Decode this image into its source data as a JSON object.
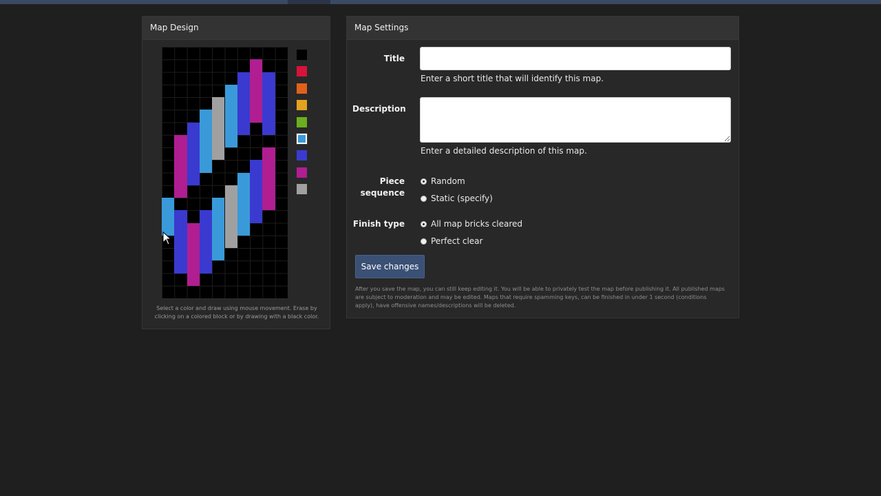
{
  "design": {
    "header": "Map Design",
    "hint": "Select a color and draw using mouse movement. Erase by clicking on a colored block or by drawing with a black color.",
    "selected_color": "#3a9ad9",
    "palette": [
      {
        "name": "black",
        "color": "#000000"
      },
      {
        "name": "red",
        "color": "#d8123a"
      },
      {
        "name": "orange",
        "color": "#e0621a"
      },
      {
        "name": "yellow",
        "color": "#e4a21e"
      },
      {
        "name": "green",
        "color": "#6aaf1e"
      },
      {
        "name": "light-blue",
        "color": "#3a9ad9"
      },
      {
        "name": "blue",
        "color": "#3a3ad0"
      },
      {
        "name": "magenta",
        "color": "#b01e92"
      },
      {
        "name": "gray",
        "color": "#a0a0a0"
      }
    ],
    "grid": {
      "cols": 10,
      "rows": 20,
      "columns": [
        {
          "col": 0,
          "color": "light-blue",
          "start": 12,
          "end": 15
        },
        {
          "col": 1,
          "color": "magenta",
          "start": 7,
          "end": 12
        },
        {
          "col": 1,
          "color": "blue",
          "start": 13,
          "end": 18
        },
        {
          "col": 2,
          "color": "blue",
          "start": 6,
          "end": 11
        },
        {
          "col": 2,
          "color": "magenta",
          "start": 14,
          "end": 19
        },
        {
          "col": 3,
          "color": "light-blue",
          "start": 5,
          "end": 10
        },
        {
          "col": 3,
          "color": "blue",
          "start": 13,
          "end": 18
        },
        {
          "col": 4,
          "color": "gray",
          "start": 4,
          "end": 9
        },
        {
          "col": 4,
          "color": "light-blue",
          "start": 12,
          "end": 17
        },
        {
          "col": 5,
          "color": "light-blue",
          "start": 3,
          "end": 8
        },
        {
          "col": 5,
          "color": "gray",
          "start": 11,
          "end": 16
        },
        {
          "col": 6,
          "color": "blue",
          "start": 2,
          "end": 7
        },
        {
          "col": 6,
          "color": "light-blue",
          "start": 10,
          "end": 15
        },
        {
          "col": 7,
          "color": "magenta",
          "start": 1,
          "end": 6
        },
        {
          "col": 7,
          "color": "blue",
          "start": 9,
          "end": 14
        },
        {
          "col": 8,
          "color": "blue",
          "start": 2,
          "end": 7
        },
        {
          "col": 8,
          "color": "magenta",
          "start": 8,
          "end": 13
        }
      ]
    }
  },
  "settings": {
    "header": "Map Settings",
    "title": {
      "label": "Title",
      "value": "",
      "help": "Enter a short title that will identify this map."
    },
    "description": {
      "label": "Description",
      "value": "",
      "help": "Enter a detailed description of this map."
    },
    "piece_sequence": {
      "label_line1": "Piece",
      "label_line2": "sequence",
      "options": [
        {
          "label": "Random",
          "checked": true
        },
        {
          "label": "Static (specify)",
          "checked": false
        }
      ]
    },
    "finish_type": {
      "label": "Finish type",
      "options": [
        {
          "label": "All map bricks cleared",
          "checked": true
        },
        {
          "label": "Perfect clear",
          "checked": false
        }
      ]
    },
    "save_label": "Save changes",
    "footnote": "After you save the map, you can still keep editing it. You will be able to privately test the map before publishing it. All published maps are subject to moderation and may be edited. Maps that require spamming keys, can be finished in under 1 second (conditions apply), have offensive names/descriptions will be deleted."
  }
}
